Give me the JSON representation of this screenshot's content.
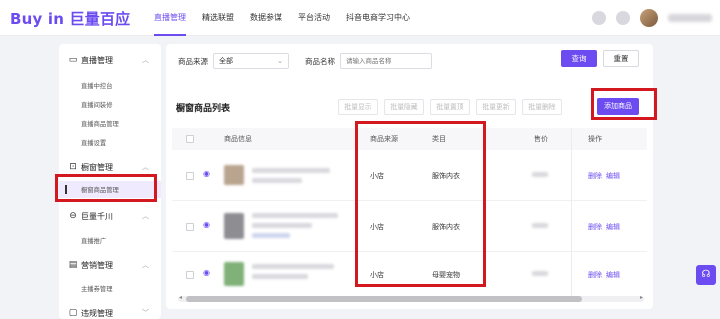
{
  "app": {
    "logo_text": "Buy in 巨量百应"
  },
  "top_nav": [
    {
      "label": "直播管理",
      "active": true
    },
    {
      "label": "精选联盟",
      "active": false
    },
    {
      "label": "数据参谋",
      "active": false
    },
    {
      "label": "平台活动",
      "active": false
    },
    {
      "label": "抖音电商学习中心",
      "active": false
    }
  ],
  "sidebar": {
    "groups": [
      {
        "label": "直播管理",
        "icon": "live-icon",
        "items": [
          "直播中控台",
          "直播间装修",
          "直播商品管理",
          "直播设置"
        ]
      },
      {
        "label": "橱窗管理",
        "icon": "showcase-icon",
        "items": [
          "橱窗商品管理"
        ],
        "active_item": "橱窗商品管理"
      },
      {
        "label": "巨量千川",
        "icon": "qianchuan-icon",
        "items": [
          "直播推广"
        ]
      },
      {
        "label": "营销管理",
        "icon": "marketing-icon",
        "items": [
          "主播券管理"
        ]
      },
      {
        "label": "违规管理",
        "icon": "violation-icon",
        "items": []
      }
    ]
  },
  "filter": {
    "source_label": "商品来源",
    "source_value": "全部",
    "name_label": "商品名称",
    "name_placeholder": "请输入商品名称",
    "search_button": "查询",
    "reset_button": "重置"
  },
  "list": {
    "title": "橱窗商品列表",
    "bulk_actions": [
      "批量显示",
      "批量隐藏",
      "批量置顶",
      "批量更新",
      "批量删除"
    ],
    "add_button": "添加商品",
    "columns": [
      "商品信息",
      "商品来源",
      "类目",
      "售价",
      "操作"
    ],
    "rows": [
      {
        "source": "小店",
        "category": "服饰内衣",
        "ops": [
          "删除",
          "编辑"
        ]
      },
      {
        "source": "小店",
        "category": "服饰内衣",
        "ops": [
          "删除",
          "编辑"
        ]
      },
      {
        "source": "小店",
        "category": "母婴宠物",
        "ops": [
          "删除",
          "编辑"
        ]
      }
    ]
  },
  "colors": {
    "accent": "#6c4cf1",
    "highlight": "#d4181f"
  }
}
